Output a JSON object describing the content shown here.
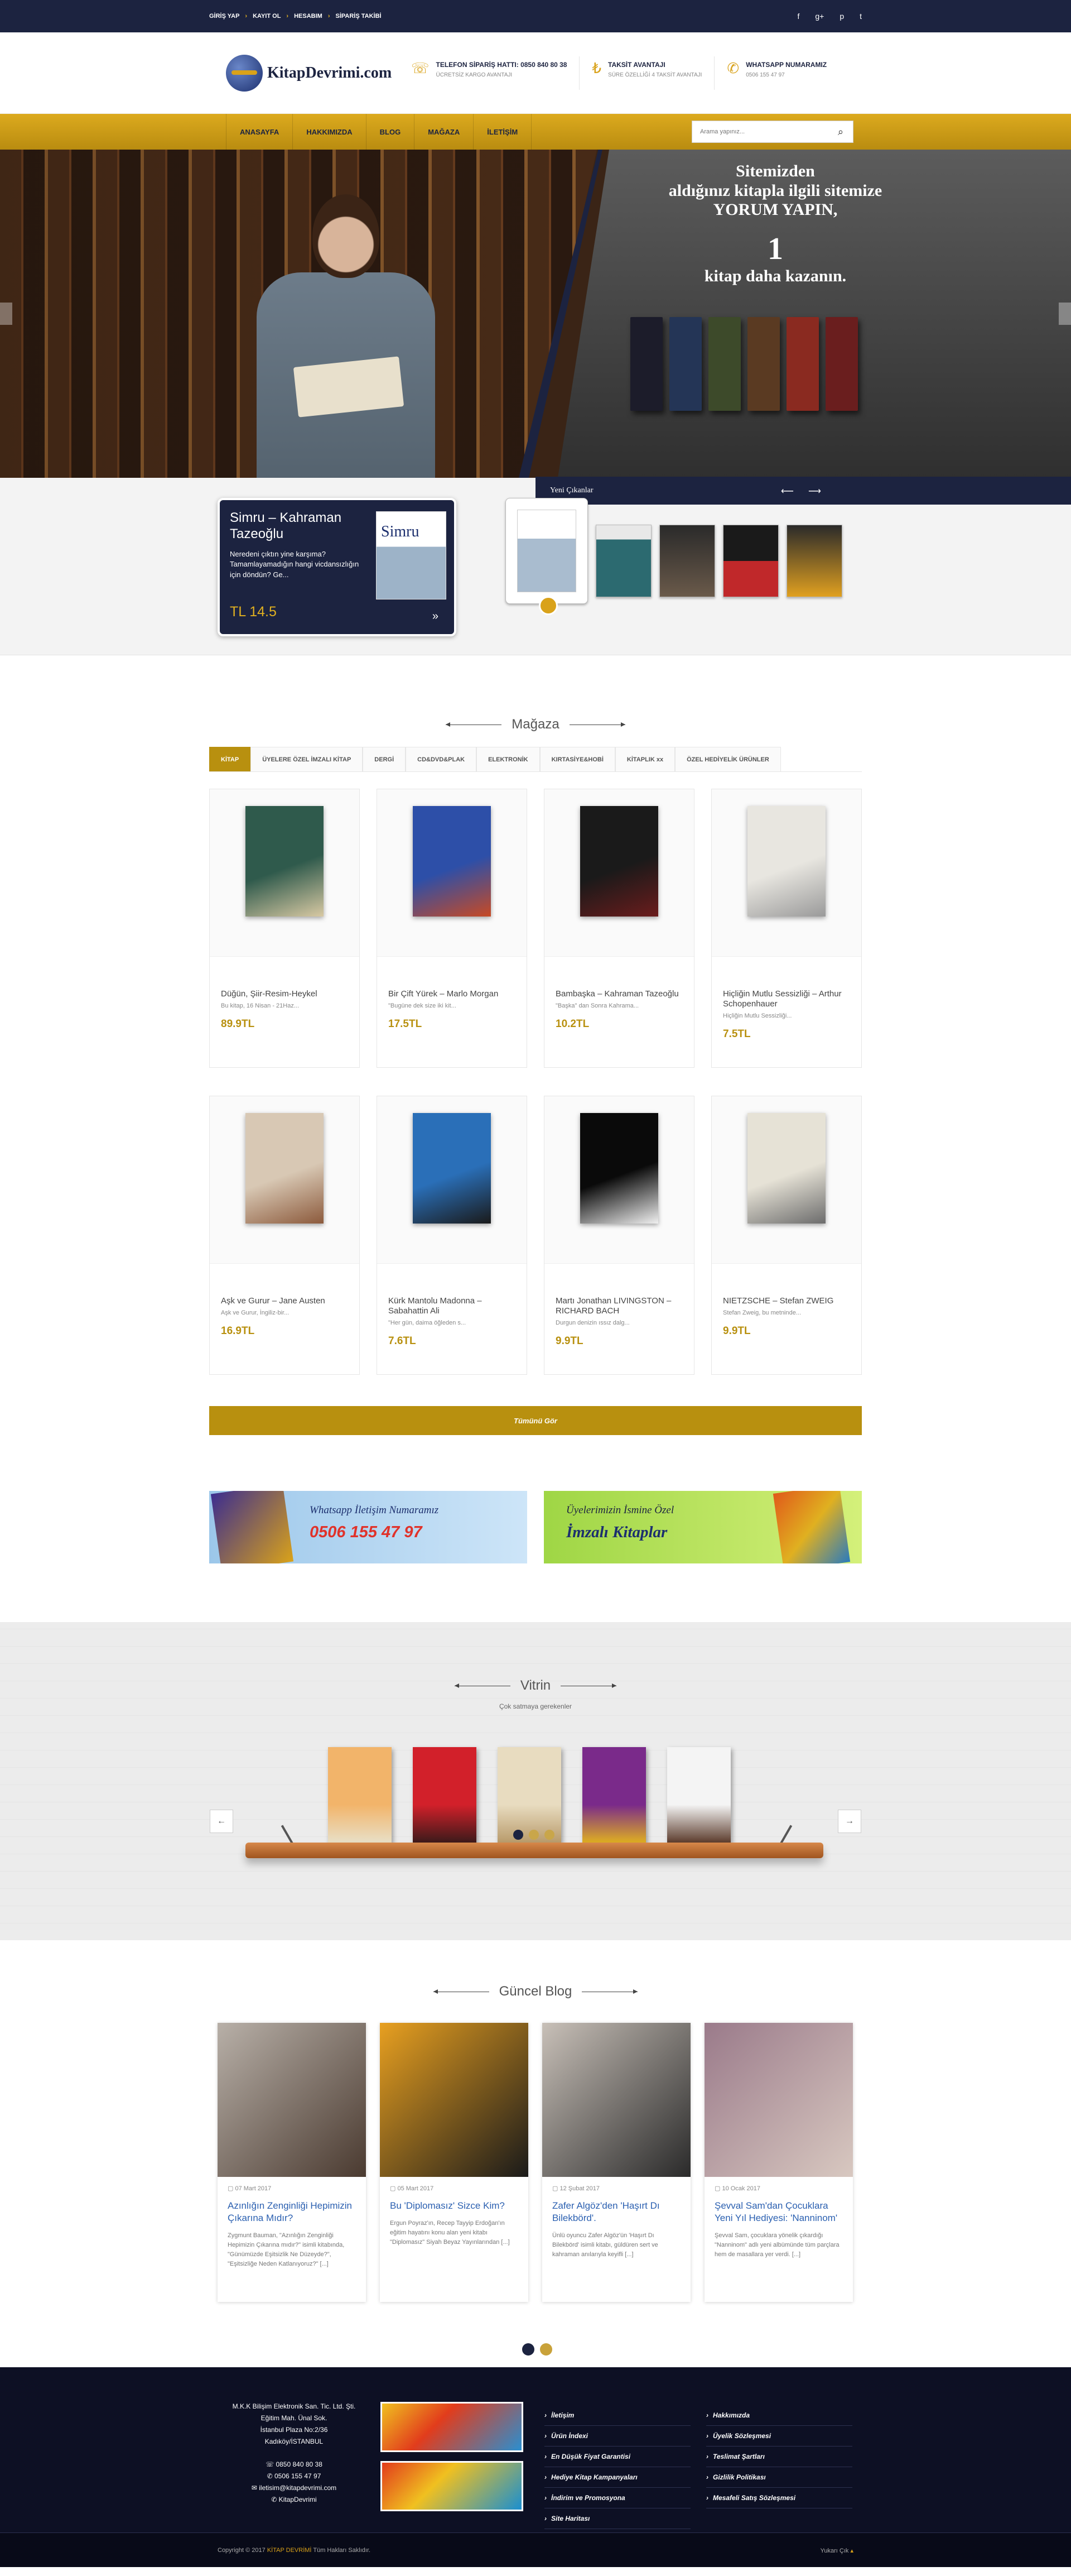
{
  "topbar": {
    "links": [
      "GİRİŞ YAP",
      "KAYIT OL",
      "HESABIM",
      "SİPARİŞ TAKİBİ"
    ],
    "social": [
      "f",
      "g+",
      "p",
      "t"
    ]
  },
  "logo": {
    "text": "KitapDevrimi.com"
  },
  "header": {
    "phone_title": "TELEFON SİPARİŞ HATTI: 0850 840 80 38",
    "phone_sub": "ÜCRETSİZ KARGO AVANTAJI",
    "install_title": "TAKSİT AVANTAJI",
    "install_sub": "SÜRE ÖZELLİĞİ 4 TAKSİT AVANTAJI",
    "wa_title": "WHATSAPP NUMARAMIZ",
    "wa_sub": "0506 155 47 97"
  },
  "nav": {
    "items": [
      "ANASAYFA",
      "HAKKIMIZDA",
      "BLOG",
      "MAĞAZA",
      "İLETİŞİM"
    ],
    "search_placeholder": "Arama yapınız..."
  },
  "hero": {
    "line1": "Sitemizden",
    "line2": "aldığınız kitapla ilgili sitemize",
    "line3": "YORUM YAPIN,",
    "num": "1",
    "line4": "kitap daha kazanın."
  },
  "new_releases": {
    "title": "Yeni Çıkanlar",
    "book_title": "Simru – Kahraman Tazeoğlu",
    "book_desc": "Neredeni çıktın yine karşıma? Tamamlayamadığın hangi vicdansızlığın için döndün? Ge...",
    "price": "TL 14.5",
    "cover_word": "Simru"
  },
  "store": {
    "title": "Mağaza",
    "tabs": [
      "KİTAP",
      "ÜYELERE ÖZEL İMZALI KİTAP",
      "DERGİ",
      "CD&DVD&PLAK",
      "ELEKTRONİK",
      "KIRTASİYE&HOBİ",
      "KİTAPLIK xx",
      "ÖZEL HEDİYELİK ÜRÜNLER"
    ],
    "products": [
      {
        "name": "Düğün, Şiir-Resim-Heykel",
        "desc": "Bu kitap, 16 Nisan - 21Haz...",
        "price": "89.9TL",
        "c1": "#2f5a4c",
        "c2": "#d8c9a3"
      },
      {
        "name": "Bir Çift Yürek – Marlo Morgan",
        "desc": "\"Bugüne dek size iki kit...",
        "price": "17.5TL",
        "c1": "#2d4fa8",
        "c2": "#c84a24"
      },
      {
        "name": "Bambaşka – Kahraman Tazeoğlu",
        "desc": "\"Başka\" dan Sonra Kahrama...",
        "price": "10.2TL",
        "c1": "#1a1a1a",
        "c2": "#6b1c1c"
      },
      {
        "name": "Hiçliğin Mutlu Sessizliği – Arthur Schopenhauer",
        "desc": "Hiçliğin Mutlu Sessizliği...",
        "price": "7.5TL",
        "c1": "#e8e6e0",
        "c2": "#9a9a9a"
      },
      {
        "name": "Aşk ve Gurur – Jane Austen",
        "desc": "Aşk ve Gurur, İngiliz-bir...",
        "price": "16.9TL",
        "c1": "#d8c8b4",
        "c2": "#8c5a3c"
      },
      {
        "name": "Kürk Mantolu Madonna – Sabahattin Ali",
        "desc": "\"Her gün, daima öğleden s...",
        "price": "7.6TL",
        "c1": "#2a6fb8",
        "c2": "#1a1a1a"
      },
      {
        "name": "Martı Jonathan LIVINGSTON – RICHARD BACH",
        "desc": "Durgun denizin ıssız dalg...",
        "price": "9.9TL",
        "c1": "#0a0a0a",
        "c2": "#f0f0f0"
      },
      {
        "name": "NIETZSCHE – Stefan ZWEIG",
        "desc": "Stefan Zweig, bu metninde...",
        "price": "9.9TL",
        "c1": "#e6e2d6",
        "c2": "#6c6c6c"
      }
    ],
    "all_button": "Tümünü Gör",
    "banner1_top": "Whatsapp İletişim Numaramız",
    "banner1_num": "0506 155 47 97",
    "banner2_top": "Üyelerimizin İsmine Özel",
    "banner2_main": "İmzalı Kitaplar"
  },
  "vitrin": {
    "title": "Vitrin",
    "subtitle": "Çok satmaya gerekenler",
    "books": [
      {
        "c1": "#f2b46a",
        "c2": "#e8e0c8"
      },
      {
        "c1": "#d2202a",
        "c2": "#3a1a1a"
      },
      {
        "c1": "#e8dcc0",
        "c2": "#b89a6a"
      },
      {
        "c1": "#7a2a8a",
        "c2": "#e0b020"
      },
      {
        "c1": "#f4f4f4",
        "c2": "#5a3a2a"
      }
    ]
  },
  "blog": {
    "title": "Güncel Blog",
    "posts": [
      {
        "date": "07 Mart 2017",
        "title": "Azınlığın Zenginliği Hepimizin Çıkarına Mıdır?",
        "text": "Zygmunt Bauman, \"Azınlığın Zenginliği Hepimizin Çıkarına mıdır?\" isimli kitabında, \"Günümüzde Eşitsizlik Ne Düzeyde?\", \"Eşitsizliğe Neden Katlanıyoruz?\" [...]",
        "c1": "#b8b0a8",
        "c2": "#4a3a30"
      },
      {
        "date": "05 Mart 2017",
        "title": "Bu 'Diplomasız' Sizce Kim?",
        "text": "Ergun Poyraz'ın, Recep Tayyip Erdoğan'ın eğitim hayatını konu alan yeni kitabı \"Diplomasız\" Siyah Beyaz Yayınlarından [...]",
        "c1": "#e8a020",
        "c2": "#1a1a1a"
      },
      {
        "date": "12 Şubat 2017",
        "title": "Zafer Algöz'den 'Haşırt Dı Bilekbörd'.",
        "text": "Ünlü oyuncu Zafer Algöz'ün 'Haşırt Dı Bilekbörd' isimli kitabı, güldüren sert ve kahraman anılarıyla keyifli [...]",
        "c1": "#c8c0b8",
        "c2": "#2a2a2a"
      },
      {
        "date": "10 Ocak 2017",
        "title": "Şevval Sam'dan Çocuklara Yeni Yıl Hediyesi: 'Nanninom'",
        "text": "Şevval Sam, çocuklara yönelik çıkardığı \"Nanninom\" adlı yeni albümünde tüm parçlara hem de masallara yer verdi. [...]",
        "c1": "#9a7a8a",
        "c2": "#d8c8c0"
      }
    ]
  },
  "footer": {
    "company": [
      "M.K.K Bilişim Elektronik San. Tic. Ltd. Şti.",
      "Eğitim Mah. Ünal Sok.",
      "İstanbul Plaza No:2/36",
      "Kadıköy/İSTANBUL",
      "",
      "☏ 0850 840 80 38",
      "✆ 0506 155 47 97",
      "✉ iletisim@kitapdevrimi.com",
      "✆ KitapDevrimi"
    ],
    "links1": [
      "İletişim",
      "Ürün İndexi",
      "En Düşük Fiyat Garantisi",
      "Hediye Kitap Kampanyaları",
      "İndirim ve Promosyona",
      "Site Haritası"
    ],
    "links2": [
      "Hakkımızda",
      "Üyelik Sözleşmesi",
      "Teslimat Şartları",
      "Gizlilik Politikası",
      "Mesafeli Satış Sözleşmesi"
    ],
    "copyright_pre": "Copyright © 2017",
    "copyright_brand": "KİTAP DEVRİMİ",
    "copyright_post": "Tüm Hakları Saklıdır.",
    "up": "Yukarı Çık"
  }
}
